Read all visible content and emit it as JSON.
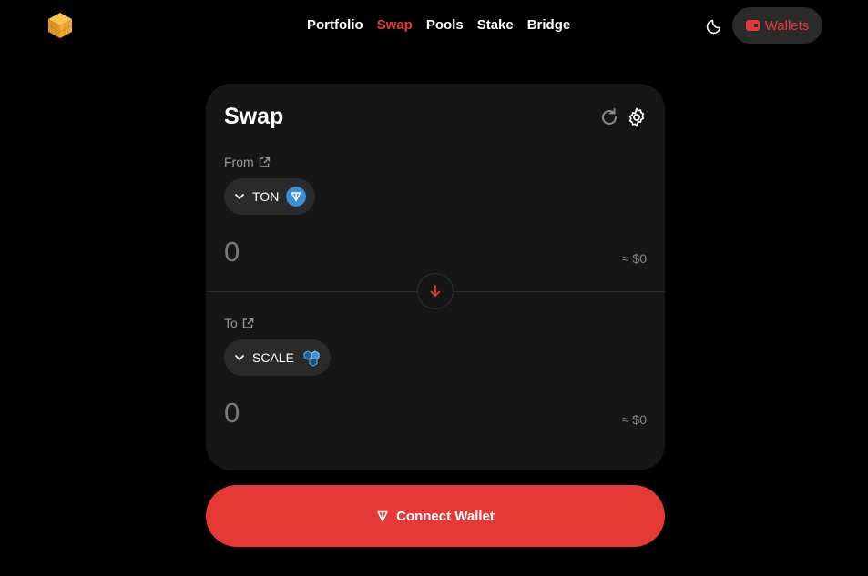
{
  "header": {
    "logo_icon": "cube-logo-icon",
    "nav": [
      {
        "label": "Portfolio",
        "active": false
      },
      {
        "label": "Swap",
        "active": true
      },
      {
        "label": "Pools",
        "active": false
      },
      {
        "label": "Stake",
        "active": false
      },
      {
        "label": "Bridge",
        "active": false
      }
    ],
    "theme_icon": "moon-icon",
    "wallets_label": "Wallets"
  },
  "swap": {
    "title": "Swap",
    "from": {
      "label": "From",
      "token": "TON",
      "amount": "0",
      "usd": "≈ $0"
    },
    "to": {
      "label": "To",
      "token": "SCALE",
      "amount": "0",
      "usd": "≈ $0"
    }
  },
  "connect_label": "Connect Wallet",
  "colors": {
    "accent": "#e53935",
    "card_bg": "#161616",
    "pill_bg": "#2a2a2a",
    "ton_blue": "#3a8fd6"
  }
}
